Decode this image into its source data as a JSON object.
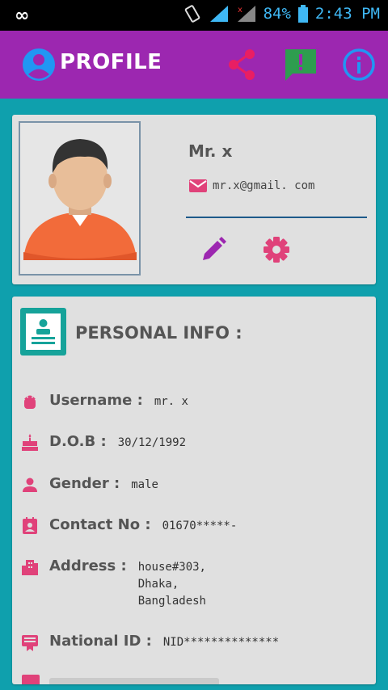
{
  "status_bar": {
    "left_icon": "infinity-icon",
    "battery": "84%",
    "time": "2:43 PM"
  },
  "app_bar": {
    "title": "PROFILE"
  },
  "profile": {
    "name": "Mr. x",
    "email": "mr.x@gmail. com"
  },
  "personal_info": {
    "header": "PERSONAL INFO :",
    "rows": [
      {
        "label": "Username :",
        "value": "mr. x",
        "icon": "android-icon"
      },
      {
        "label": "D.O.B :",
        "value": "30/12/1992",
        "icon": "cake-icon"
      },
      {
        "label": "Gender :",
        "value": "male",
        "icon": "person-icon"
      },
      {
        "label": "Contact No :",
        "value": "01670*****-",
        "icon": "contact-icon"
      },
      {
        "label": "Address :",
        "value": "house#303,\nDhaka,\nBangladesh",
        "icon": "building-icon"
      },
      {
        "label": "National ID :",
        "value": "NID**************",
        "icon": "id-card-icon"
      }
    ]
  },
  "colors": {
    "appbar": "#9c27b0",
    "background": "#0fa0ad",
    "accent_pink": "#e0427a",
    "card": "#e0e0e0"
  }
}
